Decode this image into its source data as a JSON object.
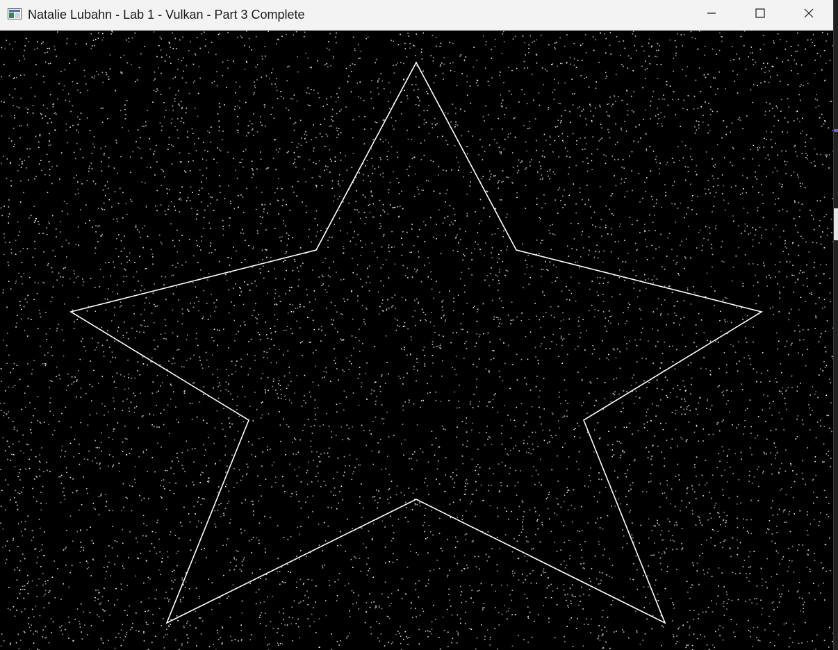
{
  "window": {
    "title": "Natalie Lubahn - Lab 1 - Vulkan - Part 3 Complete",
    "app_icon": "app-window-icon",
    "controls": {
      "minimize_icon": "minimize-icon",
      "maximize_icon": "maximize-icon",
      "close_icon": "close-icon"
    }
  },
  "scene": {
    "background_color": "#000000",
    "star_color": "#ffffff",
    "particle_color": "#ffffff",
    "shape": "five-pointed star outline over a field of white point particles"
  }
}
